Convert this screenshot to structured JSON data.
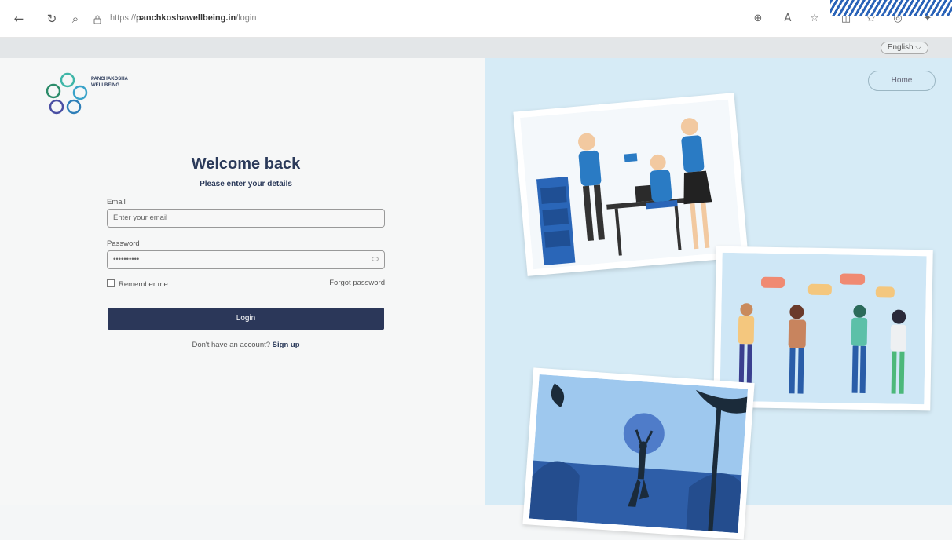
{
  "browser": {
    "url_prefix": "https://",
    "url_host": "panchkoshawellbeing.in",
    "url_path": "/login"
  },
  "language": {
    "selected": "English"
  },
  "brand": {
    "name_line1": "PANCHAKOSHA",
    "name_line2": "WELLBEING"
  },
  "header": {
    "home_label": "Home"
  },
  "login": {
    "title": "Welcome back",
    "subtitle": "Please enter your details",
    "email_label": "Email",
    "email_placeholder": "Enter your email",
    "password_label": "Password",
    "password_value": "••••••••••",
    "remember_label": "Remember me",
    "forgot_label": "Forgot password",
    "login_label": "Login",
    "signup_prompt": "Don't have an account?",
    "signup_label": "Sign up"
  },
  "colors": {
    "primary": "#2b3759",
    "right_panel_bg": "#d6ebf6",
    "illustration_blue": "#2a7bc4"
  }
}
